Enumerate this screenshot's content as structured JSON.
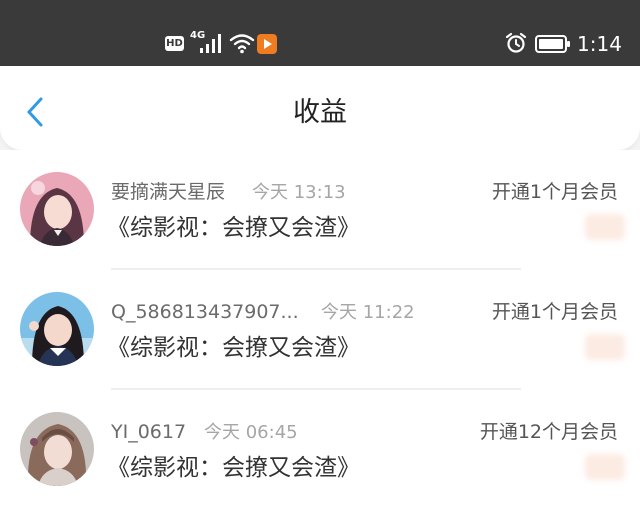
{
  "status_bar": {
    "hd_badge": "HD",
    "network_type": "4G",
    "time": "1:14",
    "icons": [
      "hd-badge-icon",
      "signal-icon",
      "wifi-icon",
      "app-notification-icon",
      "alarm-icon",
      "battery-icon"
    ]
  },
  "header": {
    "back_icon": "chevron-left-icon",
    "title": "收益"
  },
  "colors": {
    "status_bar": "#3a3a3a",
    "accent": "#2f9be7",
    "app_notification": "#f07c21"
  },
  "records": [
    {
      "user": "要摘满天星辰",
      "time": "今天 13:13",
      "action": "开通1个月会员",
      "book": "《综影视：会撩又会渣》"
    },
    {
      "user": "Q_586813437907...",
      "time": "今天 11:22",
      "action": "开通1个月会员",
      "book": "《综影视：会撩又会渣》"
    },
    {
      "user": "YI_0617",
      "time": "今天 06:45",
      "action": "开通12个月会员",
      "book": "《综影视：会撩又会渣》"
    }
  ]
}
